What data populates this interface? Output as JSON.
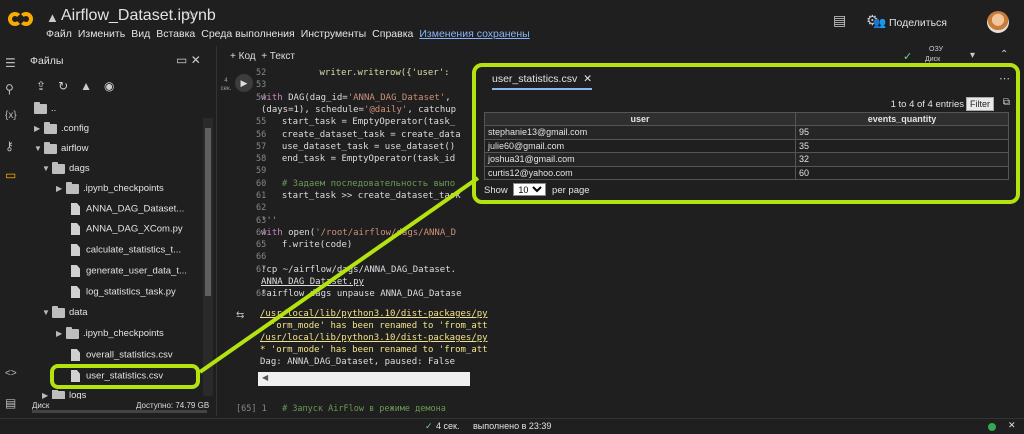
{
  "header": {
    "notebook_title": "Airflow_Dataset.ipynb",
    "menus": [
      "Файл",
      "Изменить",
      "Вид",
      "Вставка",
      "Среда выполнения",
      "Инструменты",
      "Справка"
    ],
    "saved_status": "Изменения сохранены",
    "share_label": "Поделиться"
  },
  "toolbar": {
    "add_code": "+ Код",
    "add_text": "+ Текст",
    "ram_label": "ОЗУ",
    "disk_label": "Диск"
  },
  "files_panel": {
    "title": "Файлы",
    "tree": [
      {
        "label": "..",
        "type": "up"
      },
      {
        "label": ".config",
        "type": "folder"
      },
      {
        "label": "airflow",
        "type": "folder-open"
      },
      {
        "label": "dags",
        "type": "folder-open"
      },
      {
        "label": ".ipynb_checkpoints",
        "type": "folder"
      },
      {
        "label": "ANNA_DAG_Dataset...",
        "type": "file"
      },
      {
        "label": "ANNA_DAG_XCom.py",
        "type": "file"
      },
      {
        "label": "calculate_statistics_t...",
        "type": "file"
      },
      {
        "label": "generate_user_data_t...",
        "type": "file"
      },
      {
        "label": "log_statistics_task.py",
        "type": "file"
      },
      {
        "label": "data",
        "type": "folder-open"
      },
      {
        "label": ".ipynb_checkpoints",
        "type": "folder"
      },
      {
        "label": "overall_statistics.csv",
        "type": "file"
      },
      {
        "label": "user_statistics.csv",
        "type": "file"
      },
      {
        "label": "logs",
        "type": "folder"
      }
    ],
    "disk_label": "Диск",
    "disk_free": "Доступно: 74.79 GB"
  },
  "cell": {
    "time_label": "4 сек.",
    "line_numbers": [
      "52",
      "53",
      "54",
      "",
      "55",
      "56",
      "57",
      "58",
      "59",
      "60",
      "61",
      "62",
      "63",
      "64",
      "65",
      "66",
      "67",
      "",
      "68"
    ],
    "output_lines": [
      "/usr/local/lib/python3.10/dist-packages/py",
      "  'orm_mode' has been renamed to 'from_att",
      "/usr/local/lib/python3.10/dist-packages/py",
      "* 'orm_mode' has been renamed to 'from_att",
      "Dag: ANNA_DAG_Dataset, paused: False"
    ],
    "next_cell_prefix": "[65]  1",
    "next_cell_comment": "# Запуск AirFlow в режиме демона"
  },
  "csv_viewer": {
    "tab_title": "user_statistics.csv",
    "entries_text": "1 to 4 of 4 entries",
    "filter_label": "Filter",
    "columns": [
      "user",
      "events_quantity"
    ],
    "rows": [
      [
        "stephanie13@gmail.com",
        "95"
      ],
      [
        "julie60@gmail.com",
        "35"
      ],
      [
        "joshua31@gmail.com",
        "32"
      ],
      [
        "curtis12@yahoo.com",
        "60"
      ]
    ],
    "show_label": "Show",
    "page_size": "10",
    "per_page_label": "per page"
  },
  "statusbar": {
    "time": "4 сек.",
    "executed": "выполнено в 23:39"
  },
  "colors": {
    "highlight": "#b5e30f",
    "background": "#1f1f1f"
  }
}
